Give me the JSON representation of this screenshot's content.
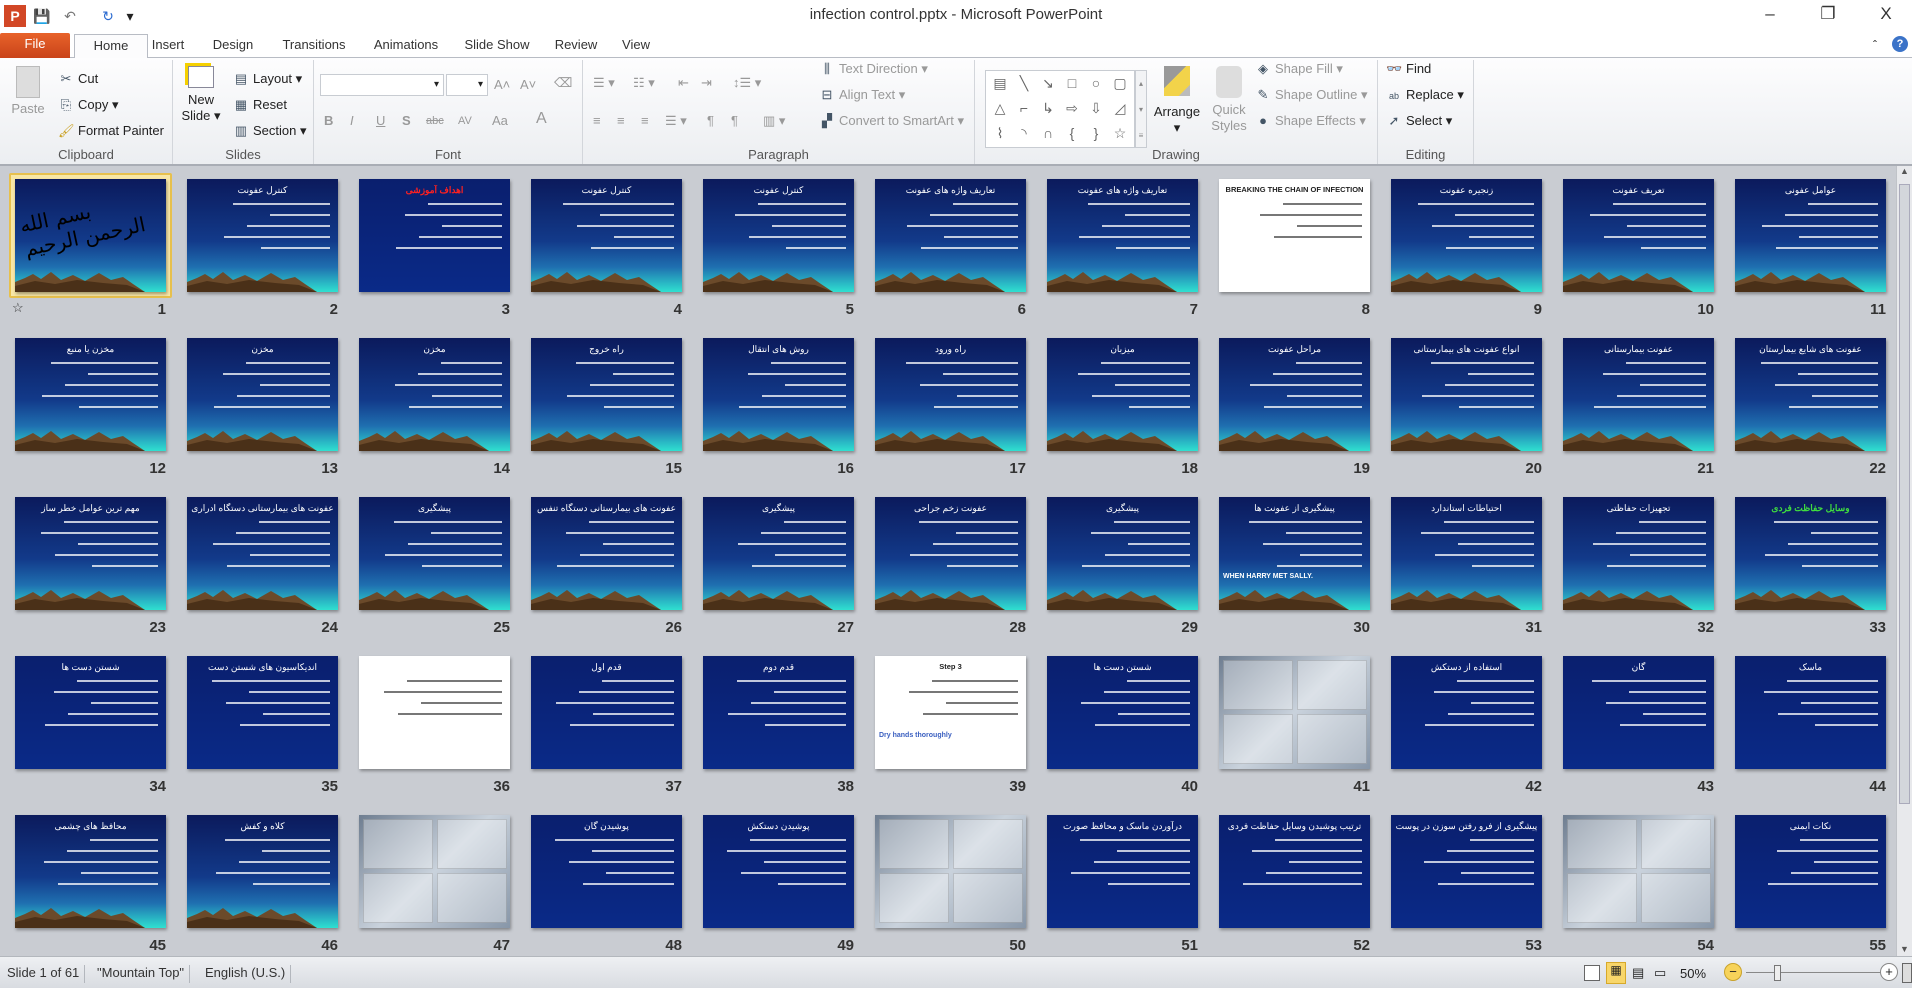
{
  "window": {
    "title": "infection control.pptx - Microsoft PowerPoint",
    "app_icon": "P",
    "minimize": "–",
    "restore": "❐",
    "close": "X",
    "help": "?",
    "collapse": "ˆ"
  },
  "quick_access": {
    "save": "💾",
    "undo": "↶",
    "redo": "↻",
    "more": "▾"
  },
  "tabs": [
    "File",
    "Home",
    "Insert",
    "Design",
    "Transitions",
    "Animations",
    "Slide Show",
    "Review",
    "View"
  ],
  "active_tab": "Home",
  "ribbon": {
    "clipboard": {
      "label": "Clipboard",
      "paste": "Paste",
      "cut": "Cut",
      "copy": "Copy",
      "format_painter": "Format Painter"
    },
    "slides": {
      "label": "Slides",
      "new_slide": "New Slide",
      "layout": "Layout",
      "reset": "Reset",
      "section": "Section"
    },
    "font": {
      "label": "Font",
      "font_name": "",
      "font_size": "",
      "bold": "B",
      "italic": "I",
      "underline": "U",
      "shadow": "S",
      "strike": "abc",
      "spacing": "AV",
      "case": "Aa",
      "color": "A",
      "grow": "A˄",
      "shrink": "A˅"
    },
    "paragraph": {
      "label": "Paragraph",
      "text_direction": "Text Direction",
      "align_text": "Align Text",
      "convert_smartart": "Convert to SmartArt"
    },
    "drawing": {
      "label": "Drawing",
      "arrange": "Arrange",
      "quick_styles": "Quick Styles",
      "shape_fill": "Shape Fill",
      "shape_outline": "Shape Outline",
      "shape_effects": "Shape Effects",
      "shapes": [
        "▤",
        "╲",
        "↘",
        "□",
        "○",
        "▢",
        "△",
        "⌐",
        "↳",
        "⇨",
        "⇩",
        "◿",
        "⌇",
        "◝",
        "∩",
        "{",
        "}",
        "☆"
      ]
    },
    "editing": {
      "label": "Editing",
      "find": "Find",
      "replace": "Replace",
      "select": "Select"
    }
  },
  "slides": [
    {
      "n": "1",
      "title": "",
      "theme": "mountain",
      "calligraphy": "بسم الله الرحمن الرحیم"
    },
    {
      "n": "2",
      "title": "کنترل عفونت",
      "theme": "mountain"
    },
    {
      "n": "3",
      "title": "اهداف آموزشی",
      "theme": "navy",
      "title_color": "#ff2020"
    },
    {
      "n": "4",
      "title": "کنترل عفونت",
      "theme": "mountain"
    },
    {
      "n": "5",
      "title": "کنترل عفونت",
      "theme": "mountain"
    },
    {
      "n": "6",
      "title": "تعاریف واژه های عفونت",
      "theme": "mountain"
    },
    {
      "n": "7",
      "title": "تعاریف واژه های عفونت",
      "theme": "mountain"
    },
    {
      "n": "8",
      "title": "BREAKING THE CHAIN OF INFECTION",
      "theme": "white"
    },
    {
      "n": "9",
      "title": "زنجیره عفونت",
      "theme": "mountain"
    },
    {
      "n": "10",
      "title": "تعریف عفونت",
      "theme": "mountain"
    },
    {
      "n": "11",
      "title": "عوامل عفونی",
      "theme": "mountain"
    },
    {
      "n": "12",
      "title": "مخزن یا منبع",
      "theme": "mountain"
    },
    {
      "n": "13",
      "title": "مخزن",
      "theme": "mountain"
    },
    {
      "n": "14",
      "title": "مخزن",
      "theme": "mountain"
    },
    {
      "n": "15",
      "title": "راه خروج",
      "theme": "mountain"
    },
    {
      "n": "16",
      "title": "روش های انتقال",
      "theme": "mountain"
    },
    {
      "n": "17",
      "title": "راه ورود",
      "theme": "mountain"
    },
    {
      "n": "18",
      "title": "میزبان",
      "theme": "mountain"
    },
    {
      "n": "19",
      "title": "مراحل عفونت",
      "theme": "mountain"
    },
    {
      "n": "20",
      "title": "انواع عفونت های بیمارستانی",
      "theme": "mountain"
    },
    {
      "n": "21",
      "title": "عفونت بیمارستانی",
      "theme": "mountain"
    },
    {
      "n": "22",
      "title": "عفونت های شایع بیمارستان",
      "theme": "mountain"
    },
    {
      "n": "23",
      "title": "مهم ترین عوامل خطر ساز",
      "theme": "mountain"
    },
    {
      "n": "24",
      "title": "عفونت های بیمارستانی دستگاه ادراری",
      "theme": "mountain"
    },
    {
      "n": "25",
      "title": "پیشگیری",
      "theme": "mountain"
    },
    {
      "n": "26",
      "title": "عفونت های بیمارستانی دستگاه تنفس",
      "theme": "mountain"
    },
    {
      "n": "27",
      "title": "پیشگیری",
      "theme": "mountain"
    },
    {
      "n": "28",
      "title": "عفونت زخم جراحی",
      "theme": "mountain"
    },
    {
      "n": "29",
      "title": "پیشگیری",
      "theme": "mountain"
    },
    {
      "n": "30",
      "title": "پیشگیری از عفونت ها",
      "theme": "mountain",
      "caption": "WHEN HARRY MET SALLY."
    },
    {
      "n": "31",
      "title": "احتیاطات استاندارد",
      "theme": "mountain"
    },
    {
      "n": "32",
      "title": "تجهیزات حفاظتی",
      "theme": "mountain"
    },
    {
      "n": "33",
      "title": "وسایل حفاظت فردی",
      "theme": "mountain",
      "title_color": "#3fdc3f"
    },
    {
      "n": "34",
      "title": "شستن دست ها",
      "theme": "navy"
    },
    {
      "n": "35",
      "title": "اندیکاسیون های شستن دست",
      "theme": "navy"
    },
    {
      "n": "36",
      "title": "",
      "theme": "white"
    },
    {
      "n": "37",
      "title": "قدم اول",
      "theme": "navy"
    },
    {
      "n": "38",
      "title": "قدم دوم",
      "theme": "navy"
    },
    {
      "n": "39",
      "title": "Step 3",
      "theme": "white",
      "caption": "Dry hands thoroughly"
    },
    {
      "n": "40",
      "title": "شستن دست ها",
      "theme": "navy"
    },
    {
      "n": "41",
      "title": "",
      "theme": "photo"
    },
    {
      "n": "42",
      "title": "استفاده از دستکش",
      "theme": "navy"
    },
    {
      "n": "43",
      "title": "گان",
      "theme": "navy"
    },
    {
      "n": "44",
      "title": "ماسک",
      "theme": "navy"
    },
    {
      "n": "45",
      "title": "محافظ های چشمی",
      "theme": "mountain"
    },
    {
      "n": "46",
      "title": "کلاه و کفش",
      "theme": "mountain"
    },
    {
      "n": "47",
      "title": "",
      "theme": "photo"
    },
    {
      "n": "48",
      "title": "پوشیدن گان",
      "theme": "navy"
    },
    {
      "n": "49",
      "title": "پوشیدن دستکش",
      "theme": "navy"
    },
    {
      "n": "50",
      "title": "",
      "theme": "photo"
    },
    {
      "n": "51",
      "title": "درآوردن ماسک و محافظ صورت",
      "theme": "navy"
    },
    {
      "n": "52",
      "title": "ترتیب پوشیدن وسایل حفاظت فردی",
      "theme": "navy"
    },
    {
      "n": "53",
      "title": "پیشگیری از فرو رفتن سوزن در پوست",
      "theme": "navy"
    },
    {
      "n": "54",
      "title": "",
      "theme": "photo"
    },
    {
      "n": "55",
      "title": "نکات ایمنی",
      "theme": "navy"
    }
  ],
  "selected_slide": "1",
  "status": {
    "slide": "Slide 1 of 61",
    "theme": "\"Mountain Top\"",
    "language": "English (U.S.)",
    "zoom": "50%",
    "zoom_value_percent": 50
  },
  "colors": {
    "accent": "#e7c04d",
    "file_tab": "#d34f1f",
    "slide_bg": "#0a2a88"
  }
}
